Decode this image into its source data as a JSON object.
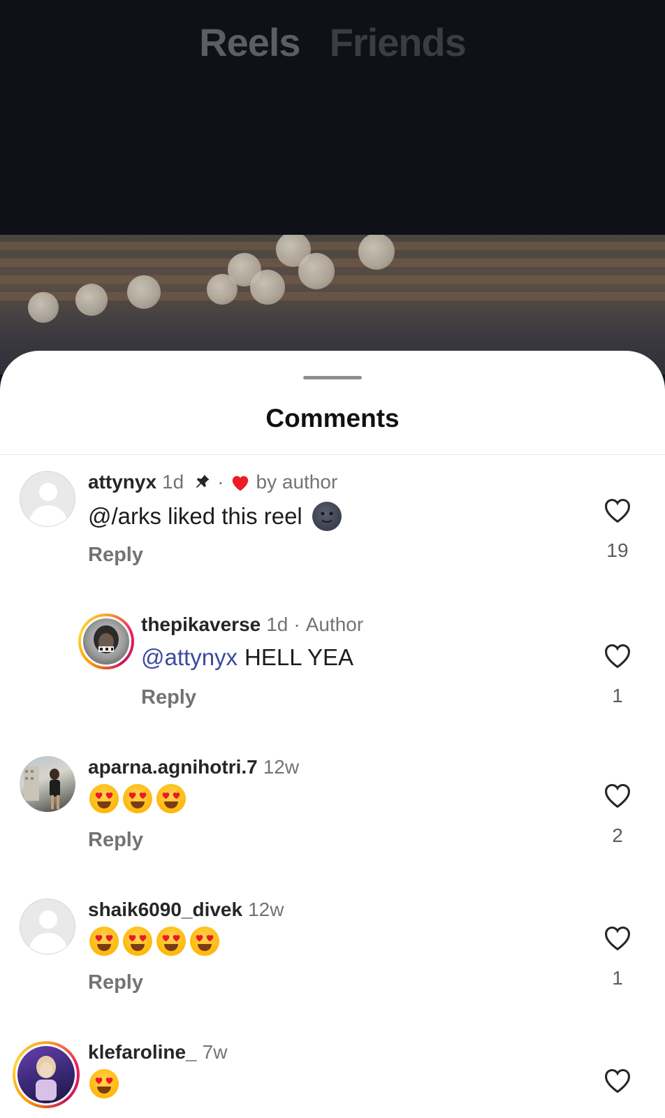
{
  "tabs": [
    {
      "label": "Reels"
    },
    {
      "label": "Friends"
    }
  ],
  "sheet": {
    "title": "Comments"
  },
  "comments": [
    {
      "username": "attynyx",
      "time": "1d",
      "pinned": true,
      "liked_by_author": "by author",
      "text": "@/arks liked this reel",
      "emoji": "new-moon-face",
      "reply_label": "Reply",
      "likes": "19",
      "avatar": "default-avatar"
    },
    {
      "username": "thepikaverse",
      "time": "1d",
      "badge": "Author",
      "mention": "@attynyx",
      "text": "HELL YEA",
      "reply_label": "Reply",
      "likes": "1",
      "avatar": "story-ring-avatar"
    },
    {
      "username": "aparna.agnihotri.7",
      "time": "12w",
      "emojis": [
        "heart-eyes",
        "heart-eyes",
        "heart-eyes"
      ],
      "reply_label": "Reply",
      "likes": "2",
      "avatar": "photo-avatar"
    },
    {
      "username": "shaik6090_divek",
      "time": "12w",
      "emojis": [
        "heart-eyes",
        "heart-eyes",
        "heart-eyes",
        "heart-eyes"
      ],
      "reply_label": "Reply",
      "likes": "1",
      "avatar": "default-avatar"
    },
    {
      "username": "klefaroline_",
      "time": "7w",
      "emojis": [
        "heart-eyes"
      ],
      "avatar": "story-ring-avatar"
    }
  ],
  "colors": {
    "heart_red": "#ed1c24",
    "mention_blue": "#3c4a9c",
    "secondary_text": "#737373"
  }
}
